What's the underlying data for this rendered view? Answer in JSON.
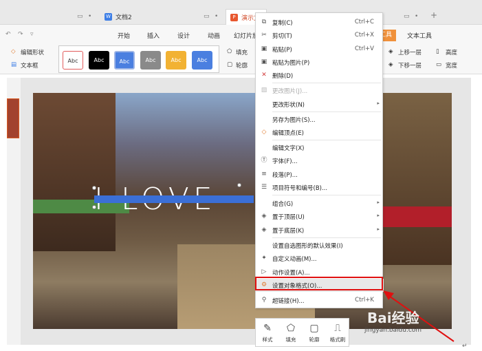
{
  "titlebar": {
    "doc_tab": "文档2",
    "ppt_tab": "演示文"
  },
  "menu": {
    "items": [
      "开始",
      "插入",
      "设计",
      "动画",
      "幻灯片放"
    ],
    "tools_tab": "工具",
    "text_tools": "文本工具"
  },
  "ribbon": {
    "edit_shape": "编辑形状",
    "textbox": "文本框",
    "fill": "填充",
    "outline": "轮廓",
    "bring_forward": "上移一层",
    "send_backward": "下移一层",
    "height": "高度",
    "width": "宽度",
    "swatch_label": "Abc"
  },
  "slide": {
    "text": "I LOVE"
  },
  "context_menu": {
    "copy": "复制(C)",
    "copy_sc": "Ctrl+C",
    "cut": "剪切(T)",
    "cut_sc": "Ctrl+X",
    "paste": "粘贴(P)",
    "paste_sc": "Ctrl+V",
    "paste_as_image": "粘贴为图片(P)",
    "delete": "删除(D)",
    "change_image": "更改图片(J)...",
    "change_shape": "更改形状(N)",
    "save_as_image": "另存为图片(S)...",
    "edit_points": "编辑顶点(E)",
    "edit_text": "编辑文字(X)",
    "font": "字体(F)...",
    "paragraph": "段落(P)...",
    "bullets": "项目符号和编号(B)...",
    "group": "组合(G)",
    "bring_to_front": "置于顶层(U)",
    "send_to_back": "置于底层(K)",
    "set_default": "设置自选图形的默认效果(I)",
    "custom_animation": "自定义动画(M)...",
    "action_settings": "动作设置(A)...",
    "format_object": "设置对象格式(O)...",
    "hyperlink": "超链接(H)...",
    "hyperlink_sc": "Ctrl+K"
  },
  "mini_toolbar": {
    "style": "样式",
    "fill": "填充",
    "outline": "轮廓",
    "format_painter": "格式刷"
  },
  "watermark": {
    "brand": "Bai经验",
    "url": "jingyan.baidu.com"
  },
  "colors": {
    "accent_orange": "#f0913b",
    "highlight_red": "#e01010",
    "selection_blue": "#3b6fd6"
  }
}
